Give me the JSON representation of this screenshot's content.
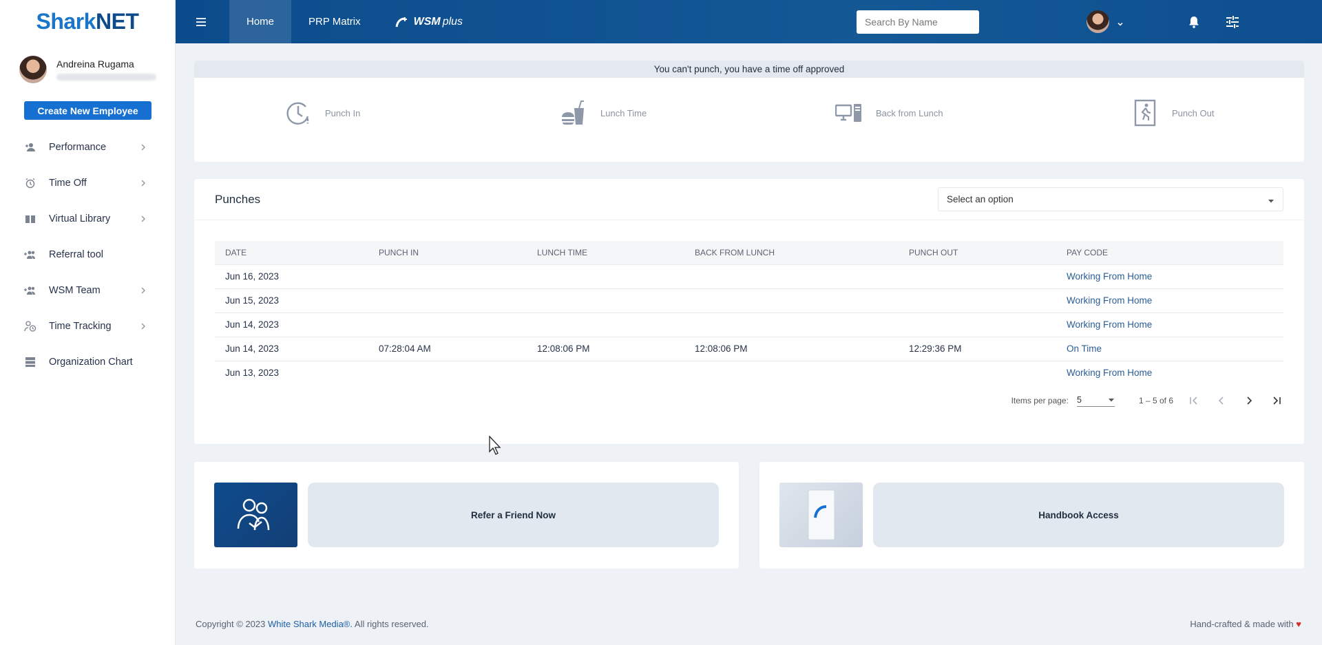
{
  "brand": {
    "part1": "Shark",
    "part2": "NET"
  },
  "user": {
    "name": "Andreina Rugama"
  },
  "sidebar": {
    "create_button": "Create New Employee",
    "items": [
      {
        "label": "Performance",
        "icon": "person-add-icon",
        "has_submenu": true
      },
      {
        "label": "Time Off",
        "icon": "alarm-clock-icon",
        "has_submenu": true
      },
      {
        "label": "Virtual Library",
        "icon": "book-icon",
        "has_submenu": true
      },
      {
        "label": "Referral tool",
        "icon": "group-add-icon",
        "has_submenu": false
      },
      {
        "label": "WSM Team",
        "icon": "group-icon",
        "has_submenu": true
      },
      {
        "label": "Time Tracking",
        "icon": "person-clock-icon",
        "has_submenu": true
      },
      {
        "label": "Organization Chart",
        "icon": "server-icon",
        "has_submenu": false
      }
    ]
  },
  "topbar": {
    "tabs": [
      {
        "label": "Home"
      },
      {
        "label": "PRP Matrix"
      }
    ],
    "wsm_logo": {
      "wsm": "WSM",
      "plus": "plus"
    },
    "search_placeholder": "Search By Name"
  },
  "punch": {
    "banner": "You can't punch, you have a time off approved",
    "actions": [
      {
        "label": "Punch In",
        "icon": "clock-icon"
      },
      {
        "label": "Lunch Time",
        "icon": "lunch-icon"
      },
      {
        "label": "Back from Lunch",
        "icon": "computer-icon"
      },
      {
        "label": "Punch Out",
        "icon": "exit-icon"
      }
    ]
  },
  "punches": {
    "title": "Punches",
    "select_value": "Select an option",
    "columns": [
      "DATE",
      "PUNCH IN",
      "LUNCH TIME",
      "BACK FROM LUNCH",
      "PUNCH OUT",
      "PAY CODE"
    ],
    "rows": [
      {
        "date": "Jun 16, 2023",
        "punch_in": "",
        "lunch": "",
        "back": "",
        "punch_out": "",
        "pay_code": "Working From Home"
      },
      {
        "date": "Jun 15, 2023",
        "punch_in": "",
        "lunch": "",
        "back": "",
        "punch_out": "",
        "pay_code": "Working From Home"
      },
      {
        "date": "Jun 14, 2023",
        "punch_in": "",
        "lunch": "",
        "back": "",
        "punch_out": "",
        "pay_code": "Working From Home"
      },
      {
        "date": "Jun 14, 2023",
        "punch_in": "07:28:04 AM",
        "lunch": "12:08:06 PM",
        "back": "12:08:06 PM",
        "punch_out": "12:29:36 PM",
        "pay_code": "On Time"
      },
      {
        "date": "Jun 13, 2023",
        "punch_in": "",
        "lunch": "",
        "back": "",
        "punch_out": "",
        "pay_code": "Working From Home"
      }
    ],
    "paginator": {
      "items_per_page_label": "Items per page:",
      "items_per_page": "5",
      "range": "1 – 5 of 6"
    }
  },
  "cards": {
    "refer": "Refer a Friend Now",
    "handbook": "Handbook Access"
  },
  "footer": {
    "copyright_prefix": "Copyright © 2023",
    "company": "White Shark Media®.",
    "rights": "All rights reserved.",
    "made_with": "Hand-crafted & made with"
  },
  "colors": {
    "primary": "#1670d1",
    "topbar": "#0c4c8c",
    "heart": "#d62b2b"
  }
}
